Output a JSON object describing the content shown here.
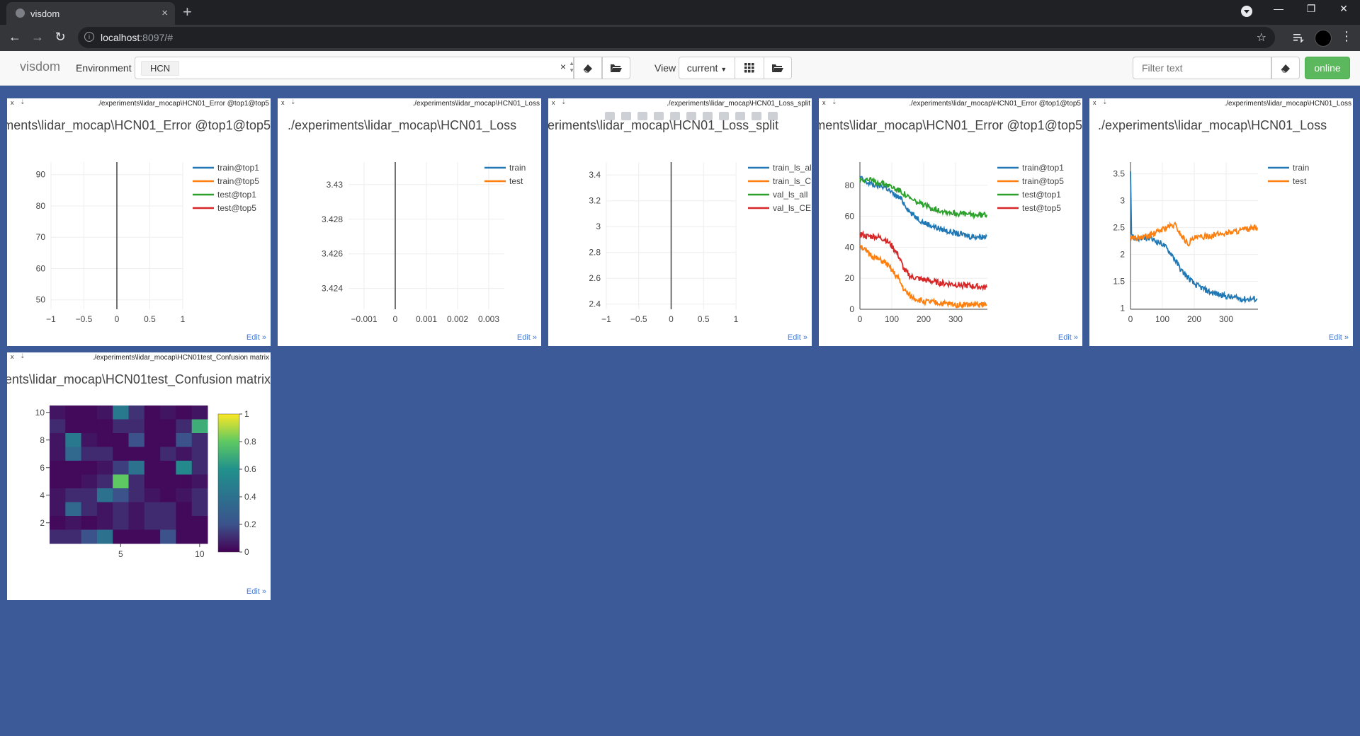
{
  "browser": {
    "tab_title": "visdom",
    "tab_close": "×",
    "new_tab": "+",
    "url_host": "localhost",
    "url_rest": ":8097/#"
  },
  "toolbar": {
    "brand": "visdom",
    "environment_label": "Environment",
    "environment_value": "HCN",
    "env_clear": "×",
    "view_label": "View",
    "view_value": "current",
    "filter_placeholder": "Filter text",
    "online_label": "online"
  },
  "panes": [
    {
      "name": "./experiments\\lidar_mocap\\HCN01_Error @top1@top5",
      "title": "./experiments\\lidar_mocap\\HCN01_Error @top1@top5",
      "edit": "Edit »",
      "chart_data": {
        "type": "line",
        "x_ticks": [
          "−1",
          "−0.5",
          "0",
          "0.5",
          "1"
        ],
        "y_ticks": [
          "50",
          "60",
          "70",
          "80",
          "90"
        ],
        "xlim": [
          -1,
          1
        ],
        "ylim": [
          47,
          94
        ],
        "series": [
          {
            "name": "train@top1",
            "color": "#1f77b4",
            "x": [],
            "y": []
          },
          {
            "name": "train@top5",
            "color": "#ff7f0e",
            "x": [],
            "y": []
          },
          {
            "name": "test@top1",
            "color": "#2ca02c",
            "x": [],
            "y": []
          },
          {
            "name": "test@top5",
            "color": "#d62728",
            "x": [],
            "y": []
          }
        ]
      }
    },
    {
      "name": "./experiments\\lidar_mocap\\HCN01_Loss",
      "title": "./experiments\\lidar_mocap\\HCN01_Loss",
      "edit": "Edit »",
      "chart_data": {
        "type": "line",
        "x_ticks": [
          "−0.001",
          "0",
          "0.001",
          "0.002",
          "0.003"
        ],
        "y_ticks": [
          "3.424",
          "3.426",
          "3.428",
          "3.43"
        ],
        "xlim": [
          -0.0015,
          0.0035
        ],
        "ylim": [
          3.4228,
          3.4313
        ],
        "series": [
          {
            "name": "train",
            "color": "#1f77b4",
            "x": [],
            "y": []
          },
          {
            "name": "test",
            "color": "#ff7f0e",
            "x": [],
            "y": []
          }
        ]
      }
    },
    {
      "name": "./experiments\\lidar_mocap\\HCN01_Loss_split",
      "title": "./experiments\\lidar_mocap\\HCN01_Loss_split",
      "edit": "Edit »",
      "chart_data": {
        "type": "line",
        "x_ticks": [
          "−1",
          "−0.5",
          "0",
          "0.5",
          "1"
        ],
        "y_ticks": [
          "2.4",
          "2.6",
          "2.8",
          "3",
          "3.2",
          "3.4"
        ],
        "xlim": [
          -1,
          1
        ],
        "ylim": [
          2.36,
          3.5
        ],
        "series": [
          {
            "name": "train_ls_all",
            "color": "#1f77b4",
            "x": [],
            "y": []
          },
          {
            "name": "train_ls_CE",
            "color": "#ff7f0e",
            "x": [],
            "y": []
          },
          {
            "name": "val_ls_all",
            "color": "#2ca02c",
            "x": [],
            "y": []
          },
          {
            "name": "val_ls_CE",
            "color": "#d62728",
            "x": [],
            "y": []
          }
        ]
      }
    },
    {
      "name": "./experiments\\lidar_mocap\\HCN01_Error @top1@top5",
      "title": "./experiments\\lidar_mocap\\HCN01_Error @top1@top5",
      "edit": "Edit »",
      "chart_data": {
        "type": "line",
        "x_ticks": [
          "0",
          "100",
          "200",
          "300"
        ],
        "y_ticks": [
          "0",
          "20",
          "40",
          "60",
          "80"
        ],
        "xlim": [
          0,
          400
        ],
        "ylim": [
          0,
          95
        ],
        "series": [
          {
            "name": "train@top1",
            "color": "#1f77b4",
            "x": [
              0,
              20,
              50,
              80,
              100,
              130,
              160,
              200,
              250,
              300,
              350,
              398
            ],
            "y": [
              85,
              82,
              80,
              79,
              75,
              71,
              62,
              56,
              52,
              49,
              47,
              47
            ]
          },
          {
            "name": "train@top5",
            "color": "#ff7f0e",
            "x": [
              0,
              20,
              50,
              80,
              100,
              120,
              140,
              160,
              200,
              250,
              300,
              350,
              398
            ],
            "y": [
              42,
              37,
              33,
              30,
              25,
              20,
              12,
              8,
              5,
              4,
              3,
              3,
              3
            ]
          },
          {
            "name": "test@top1",
            "color": "#2ca02c",
            "x": [
              0,
              20,
              50,
              80,
              100,
              130,
              160,
              200,
              250,
              300,
              350,
              398
            ],
            "y": [
              84,
              84,
              82,
              81,
              79,
              76,
              71,
              67,
              64,
              62,
              61,
              61
            ]
          },
          {
            "name": "test@top5",
            "color": "#d62728",
            "x": [
              0,
              20,
              50,
              80,
              100,
              120,
              140,
              160,
              200,
              250,
              300,
              350,
              398
            ],
            "y": [
              49,
              47,
              47,
              45,
              41,
              35,
              25,
              21,
              19,
              17,
              16,
              15,
              14
            ]
          }
        ]
      }
    },
    {
      "name": "./experiments\\lidar_mocap\\HCN01_Loss",
      "title": "./experiments\\lidar_mocap\\HCN01_Loss",
      "edit": "Edit »",
      "chart_data": {
        "type": "line",
        "x_ticks": [
          "0",
          "100",
          "200",
          "300"
        ],
        "y_ticks": [
          "1",
          "1.5",
          "2",
          "2.5",
          "3",
          "3.5"
        ],
        "xlim": [
          0,
          400
        ],
        "ylim": [
          0.98,
          3.72
        ],
        "series": [
          {
            "name": "train",
            "color": "#1f77b4",
            "x": [
              0,
              3,
              10,
              30,
              60,
              100,
              130,
              160,
              200,
              250,
              300,
              350,
              398
            ],
            "y": [
              3.6,
              2.4,
              2.3,
              2.3,
              2.3,
              2.2,
              2.0,
              1.7,
              1.45,
              1.3,
              1.22,
              1.17,
              1.17
            ]
          },
          {
            "name": "test",
            "color": "#ff7f0e",
            "x": [
              0,
              20,
              50,
              80,
              110,
              140,
              160,
              180,
              200,
              250,
              300,
              350,
              398
            ],
            "y": [
              2.33,
              2.3,
              2.33,
              2.4,
              2.5,
              2.55,
              2.35,
              2.2,
              2.3,
              2.35,
              2.4,
              2.45,
              2.5
            ]
          }
        ]
      }
    },
    {
      "name": "./experiments\\lidar_mocap\\HCN01test_Confusion matrix",
      "title": "./experiments\\lidar_mocap\\HCN01test_Confusion matrix",
      "edit": "Edit »",
      "chart_data": {
        "type": "heatmap",
        "x_ticks": [
          "5",
          "10"
        ],
        "y_ticks": [
          "2",
          "4",
          "6",
          "8",
          "10"
        ],
        "colorbar_ticks": [
          "0",
          "0.2",
          "0.4",
          "0.6",
          "0.8",
          "1"
        ],
        "rows": 10,
        "cols": 10,
        "values_top_to_bottom": [
          [
            0.05,
            0.02,
            0.02,
            0.05,
            0.45,
            0.12,
            0.02,
            0.05,
            0.02,
            0.05
          ],
          [
            0.1,
            0.02,
            0.02,
            0.02,
            0.1,
            0.1,
            0.02,
            0.02,
            0.1,
            0.7
          ],
          [
            0.05,
            0.45,
            0.05,
            0.02,
            0.02,
            0.2,
            0.02,
            0.02,
            0.2,
            0.1
          ],
          [
            0.05,
            0.35,
            0.1,
            0.1,
            0.02,
            0.02,
            0.02,
            0.1,
            0.05,
            0.1
          ],
          [
            0.02,
            0.02,
            0.02,
            0.05,
            0.15,
            0.4,
            0.02,
            0.02,
            0.55,
            0.1
          ],
          [
            0.02,
            0.02,
            0.05,
            0.1,
            0.8,
            0.1,
            0.02,
            0.02,
            0.02,
            0.05
          ],
          [
            0.05,
            0.1,
            0.1,
            0.4,
            0.2,
            0.1,
            0.05,
            0.02,
            0.05,
            0.1
          ],
          [
            0.05,
            0.35,
            0.1,
            0.05,
            0.1,
            0.05,
            0.1,
            0.1,
            0.02,
            0.1
          ],
          [
            0.02,
            0.05,
            0.02,
            0.05,
            0.1,
            0.05,
            0.1,
            0.1,
            0.02,
            0.02
          ],
          [
            0.1,
            0.1,
            0.2,
            0.4,
            0.02,
            0.02,
            0.02,
            0.2,
            0.02,
            0.02
          ]
        ]
      }
    }
  ]
}
